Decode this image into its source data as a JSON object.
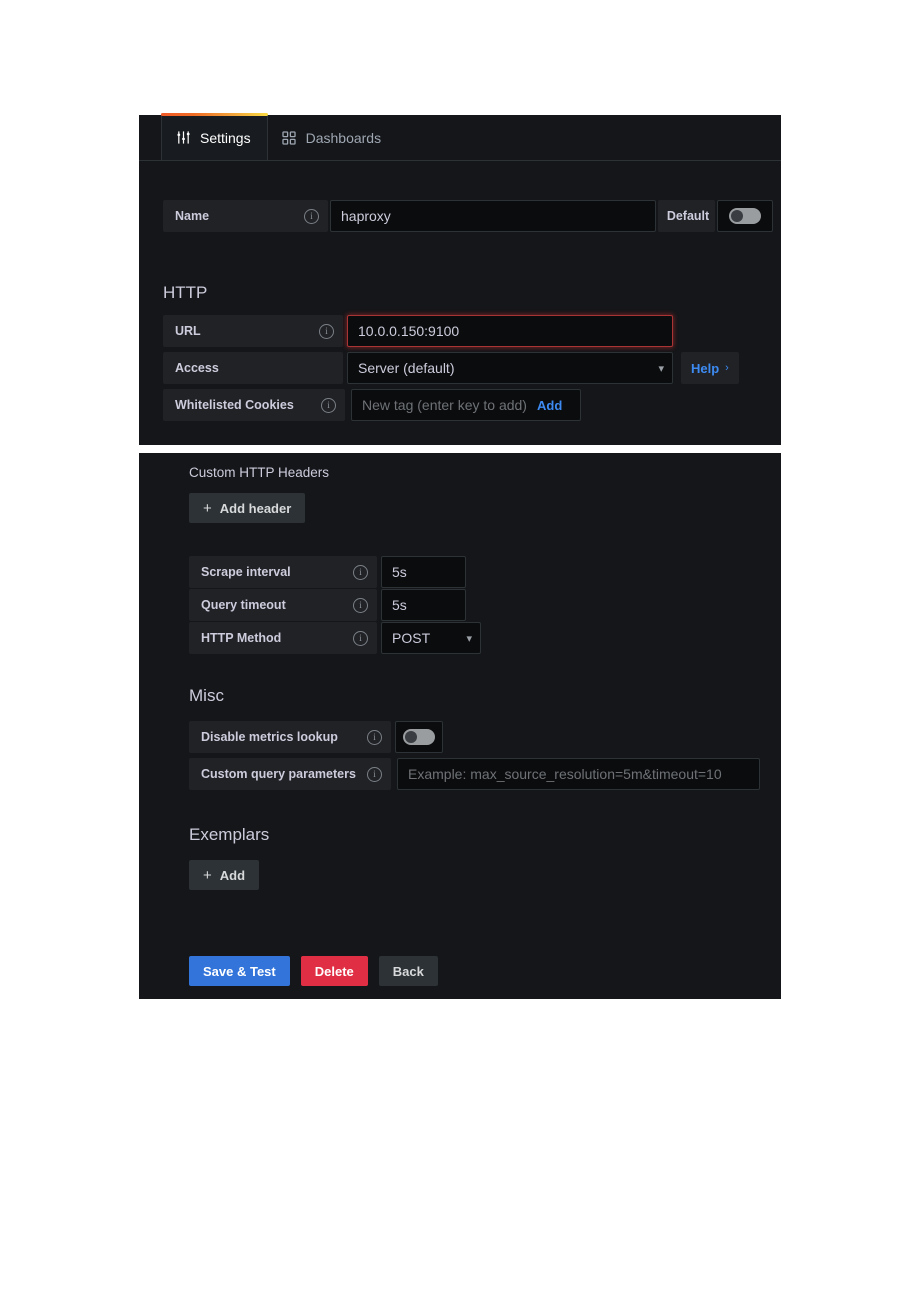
{
  "tabs": [
    {
      "label": "Settings",
      "icon": "sliders-icon",
      "active": true
    },
    {
      "label": "Dashboards",
      "icon": "grid-icon",
      "active": false
    }
  ],
  "settings": {
    "name_row": {
      "label": "Name",
      "info_icon": "info-icon",
      "value": "haproxy",
      "default_label": "Default",
      "default_toggle": "off"
    },
    "http_section": {
      "title": "HTTP",
      "url": {
        "label": "URL",
        "info_icon": "info-icon",
        "value": "10.0.0.150:9100",
        "state": "error"
      },
      "access": {
        "label": "Access",
        "value": "Server (default)",
        "caret_icon": "chevron-down-icon",
        "help_label": "Help",
        "help_caret_icon": "chevron-right-icon"
      },
      "whitelisted_cookies": {
        "label": "Whitelisted Cookies",
        "info_icon": "info-icon",
        "placeholder": "New tag (enter key to add)",
        "add_label": "Add"
      }
    },
    "custom_headers": {
      "title": "Custom HTTP Headers",
      "add_header_label": "Add header",
      "plus_icon": "plus-icon"
    },
    "intervals": [
      {
        "label": "Scrape interval",
        "info_icon": "info-icon",
        "value": "5s",
        "type": "input"
      },
      {
        "label": "Query timeout",
        "info_icon": "info-icon",
        "value": "5s",
        "type": "input"
      },
      {
        "label": "HTTP Method",
        "info_icon": "info-icon",
        "value": "POST",
        "type": "select",
        "caret_icon": "chevron-down-icon"
      }
    ],
    "misc": {
      "title": "Misc",
      "disable_metrics_lookup": {
        "label": "Disable metrics lookup",
        "info_icon": "info-icon",
        "toggle": "off"
      },
      "custom_query_parameters": {
        "label": "Custom query parameters",
        "info_icon": "info-icon",
        "placeholder": "Example: max_source_resolution=5m&timeout=10",
        "value": ""
      }
    },
    "exemplars": {
      "title": "Exemplars",
      "add_label": "Add",
      "plus_icon": "plus-icon"
    },
    "footer": {
      "save_label": "Save & Test",
      "delete_label": "Delete",
      "back_label": "Back"
    }
  },
  "colors": {
    "panel_bg": "#141619",
    "input_bg": "#0b0c0e",
    "label_bg": "#202226",
    "primary": "#3274d9",
    "danger": "#e02f44",
    "link": "#3d8bf2",
    "error_border": "#a33333",
    "accent_gradient_start": "#f05a28",
    "accent_gradient_end": "#fadb43"
  }
}
